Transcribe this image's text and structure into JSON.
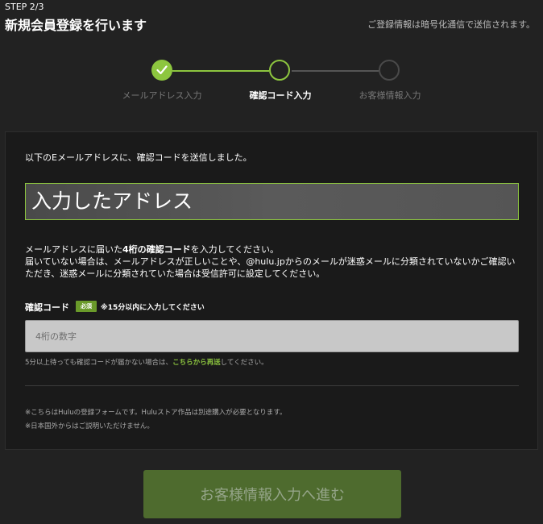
{
  "header": {
    "step": "STEP 2/3",
    "title": "新規会員登録を行います",
    "encrypt_note": "ご登録情報は暗号化通信で送信されます。"
  },
  "stepper": {
    "steps": [
      {
        "label": "メールアドレス入力",
        "state": "done"
      },
      {
        "label": "確認コード入力",
        "state": "current"
      },
      {
        "label": "お客様情報入力",
        "state": "todo"
      }
    ],
    "colors": {
      "active": "#8dc63f",
      "inactive": "#4a4a4a"
    }
  },
  "form": {
    "sent_message": "以下のEメールアドレスに、確認コードを送信しました。",
    "address": "入力したアドレス",
    "instruction_pre": "メールアドレスに届いた",
    "instruction_bold": "4桁の確認コード",
    "instruction_post": "を入力してください。",
    "instruction_line2": "届いていない場合は、メールアドレスが正しいことや、@hulu.jpからのメールが迷惑メールに分類されていないかご確認いただき、迷惑メールに分類されていた場合は受信許可に設定してください。",
    "code_label": "確認コード",
    "required_badge": "必須",
    "code_note": "※15分以内に入力してください",
    "code_placeholder": "4桁の数字",
    "code_value": "",
    "resend_pre": "5分以上待っても確認コードが届かない場合は、",
    "resend_link": "こちらから再送",
    "resend_post": "してください。",
    "footnote1": "※こちらはHuluの登録フォームです。Huluストア作品は別途購入が必要となります。",
    "footnote2": "※日本国外からはご説明いただけません。"
  },
  "proceed_button": {
    "label": "お客様情報入力へ進む",
    "enabled": false
  }
}
